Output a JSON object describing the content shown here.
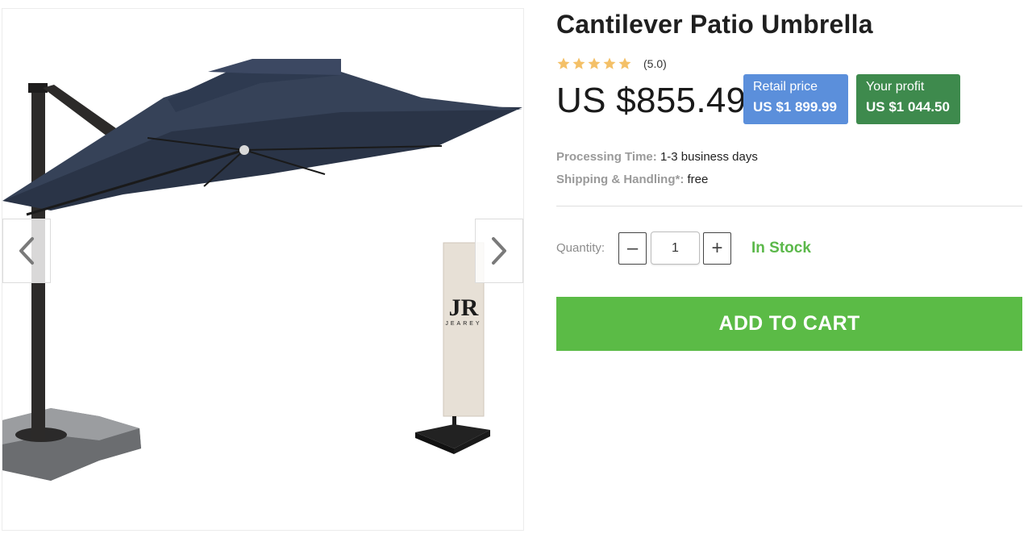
{
  "product": {
    "title": "Cantilever Patio Umbrella",
    "rating_text": "(5.0)",
    "rating_value": 5,
    "rating_max": 5,
    "price": "US $855.49"
  },
  "badges": {
    "retail_label": "Retail price",
    "retail_value": "US $1 899.99",
    "profit_label": "Your profit",
    "profit_value": "US $1 044.50"
  },
  "meta": {
    "processing_label": "Processing Time:",
    "processing_value": "1-3 business days",
    "shipping_label": "Shipping & Handling*:",
    "shipping_value": "free"
  },
  "quantity": {
    "label": "Quantity:",
    "value": "1",
    "minus_symbol": "–",
    "plus_symbol": "+"
  },
  "stock_status": "In Stock",
  "cart_button": "ADD TO CART",
  "gallery": {
    "cover_logo": "JR",
    "cover_brand": "JEAREY"
  },
  "colors": {
    "star": "#f4c067",
    "retail_badge": "#5b8fdb",
    "profit_badge": "#3e8a4d",
    "in_stock": "#5bb84a",
    "cart_button": "#5bbb46",
    "canopy": "#2f3a4f"
  },
  "icons": {
    "prev": "chevron-left-icon",
    "next": "chevron-right-icon",
    "star": "star-icon"
  }
}
